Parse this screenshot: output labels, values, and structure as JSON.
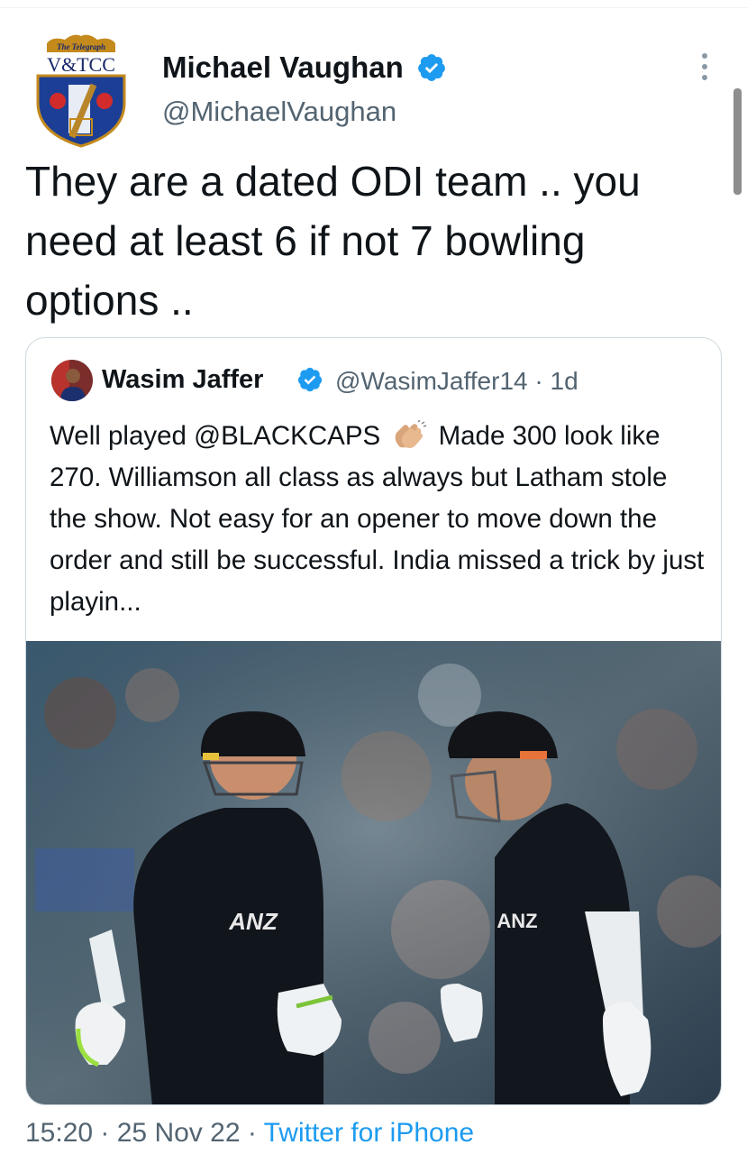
{
  "tweet": {
    "author": {
      "name": "Michael Vaughan",
      "handle": "@MichaelVaughan",
      "avatar_logo_text_top": "The Telegraph",
      "avatar_logo_text_main": "V&TCC",
      "verified": true
    },
    "text": "They are a dated ODI team .. you need at least 6 if not 7 bowling options ..",
    "more_icon": "more-vertical-icon"
  },
  "quoted_tweet": {
    "author": {
      "name": "Wasim Jaffer",
      "handle": "@WasimJaffer14",
      "verified": true
    },
    "separator": "·",
    "age": "1d",
    "text_before_emoji": "Well played @BLACKCAPS",
    "emoji_icon": "clapping-hands-icon",
    "text_after_emoji": "Made 300 look like 270. Williamson all class as always but Latham stole the show. Not easy for an opener to move down the order and still be successful. India missed a trick by just playin...",
    "media": {
      "jersey_sponsor_left": "ANZ",
      "jersey_sponsor_right": "ANZ"
    }
  },
  "footer": {
    "time": "15:20",
    "sep1": " · ",
    "date": "25 Nov 22",
    "sep2": " · ",
    "source": "Twitter for iPhone"
  },
  "colors": {
    "text_primary": "#0f1419",
    "text_secondary": "#536471",
    "link": "#1d9bf0",
    "verified": "#1d9bf0",
    "border": "#cfd9de"
  }
}
